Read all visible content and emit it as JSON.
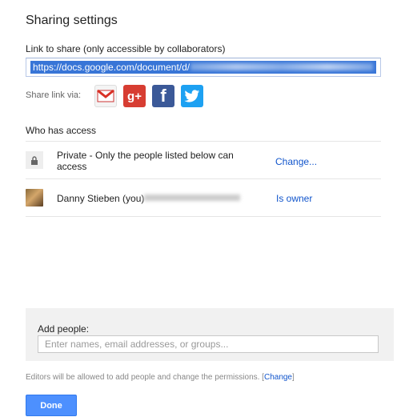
{
  "dialog": {
    "title": "Sharing settings",
    "link_label": "Link to share (only accessible by collaborators)",
    "link_value": "https://docs.google.com/document/d/",
    "share_via_label": "Share link via:",
    "share_icons": [
      "gmail-icon",
      "google-plus-icon",
      "facebook-icon",
      "twitter-icon"
    ],
    "gplus_glyph": "g+",
    "facebook_glyph": "f",
    "who_has_access": "Who has access",
    "access_rows": [
      {
        "icon": "lock-icon",
        "text": "Private - Only the people listed below can access",
        "action": "Change..."
      },
      {
        "icon": "avatar",
        "text": "Danny Stieben (you)",
        "action": "Is owner"
      }
    ],
    "add_people": {
      "label": "Add people:",
      "placeholder": "Enter names, email addresses, or groups..."
    },
    "editors_note": "Editors will be allowed to add people and change the permissions.",
    "editors_link": "Change",
    "done_label": "Done",
    "colors": {
      "selection": "#3875d7",
      "link": "#1155cc",
      "primary_button": "#4d90fe"
    }
  }
}
